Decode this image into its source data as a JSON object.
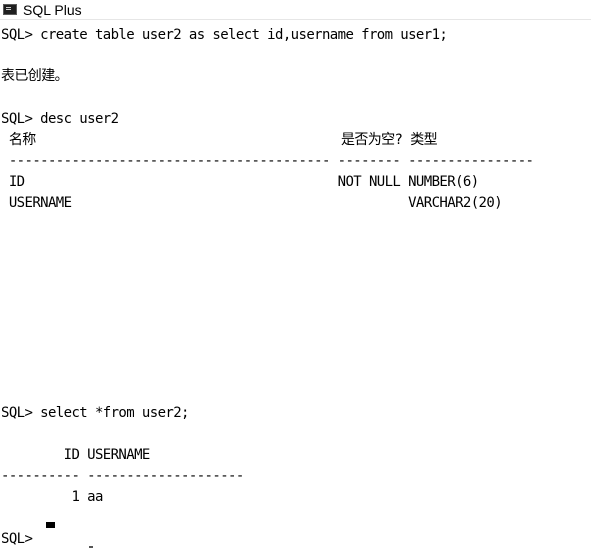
{
  "window": {
    "title": "SQL Plus"
  },
  "console": {
    "lines": [
      "SQL> create table user2 as select id,username from user1;",
      "表已创建。",
      "SQL> desc user2",
      " 名称                                       是否为空? 类型",
      " ----------------------------------------- -------- ----------------",
      " ID                                        NOT NULL NUMBER(6)",
      " USERNAME                                           VARCHAR2(20)",
      "SQL> select *from user2;",
      "        ID USERNAME",
      "---------- --------------------",
      "         1 aa",
      "SQL>"
    ]
  }
}
